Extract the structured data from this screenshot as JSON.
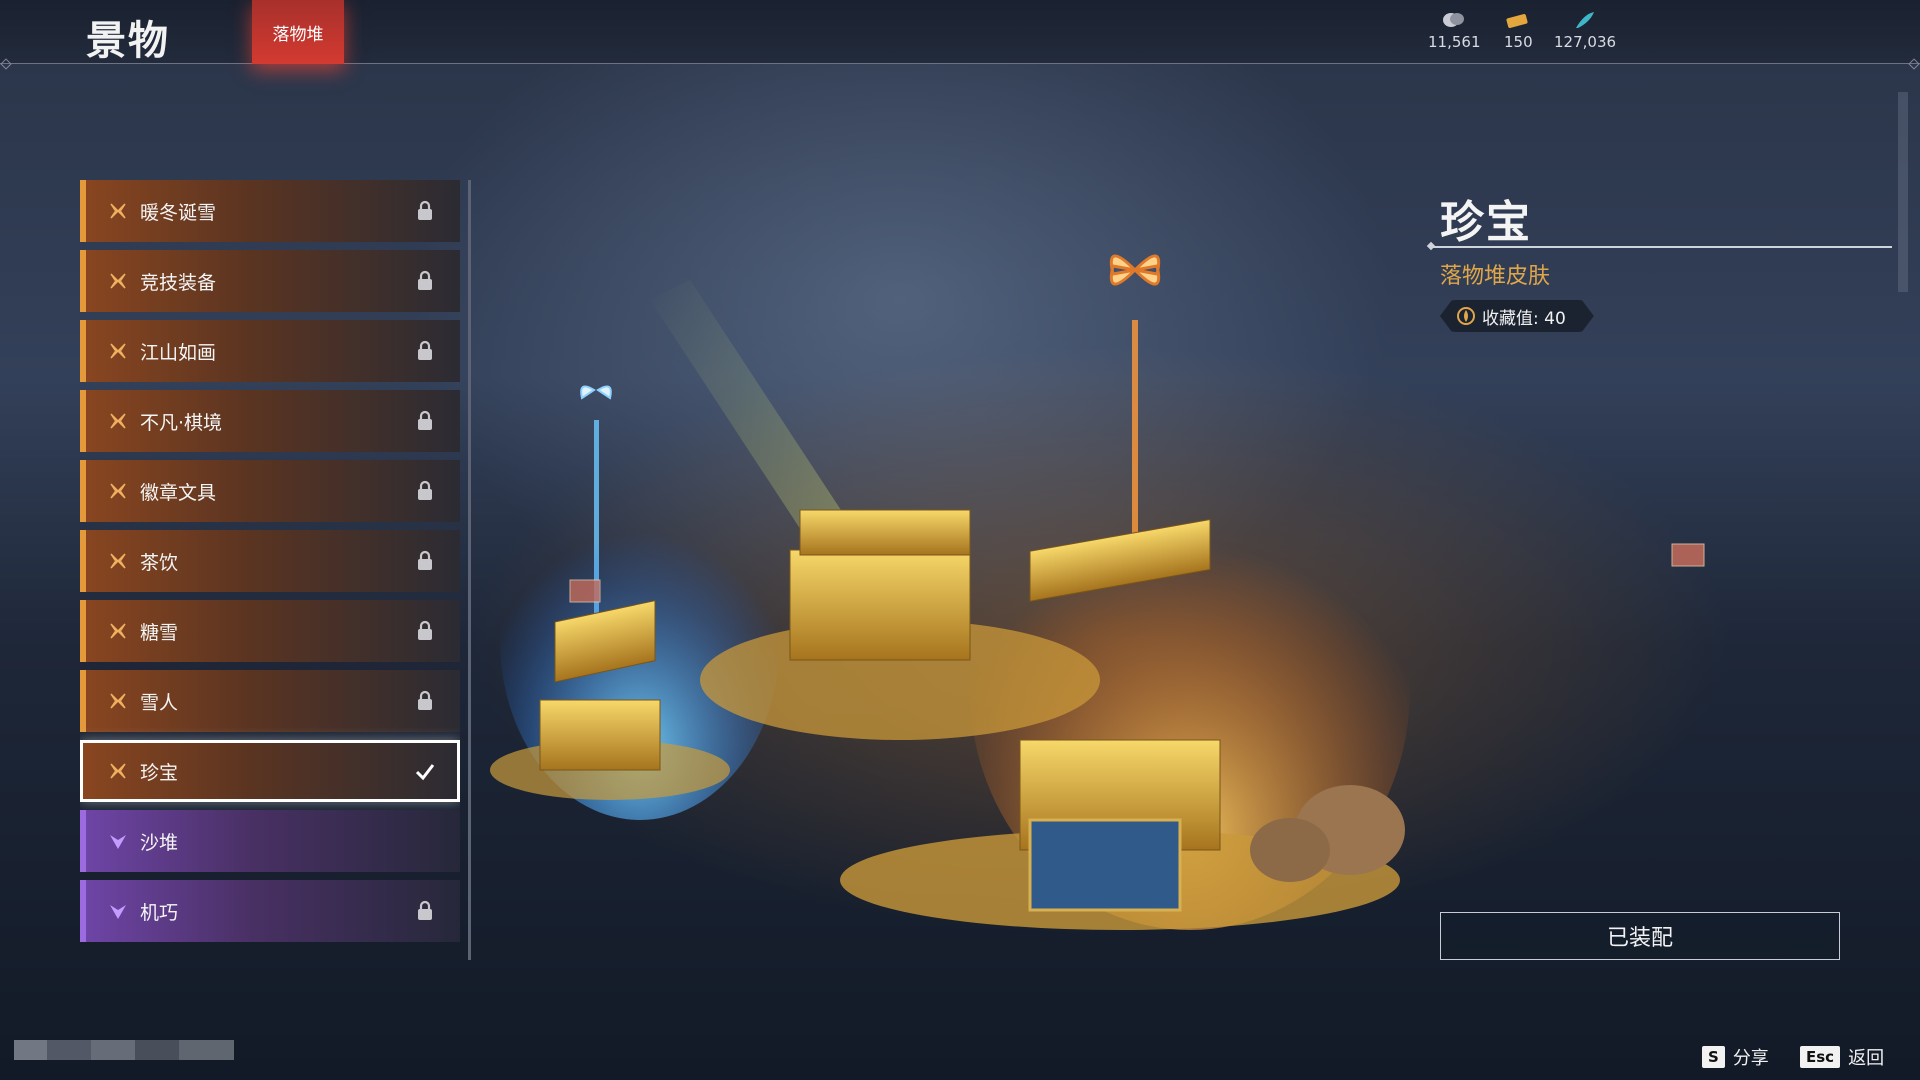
{
  "header": {
    "title": "景物",
    "active_tab": "落物堆",
    "currencies": [
      {
        "icon": "coin-stack-icon",
        "value": "11,561"
      },
      {
        "icon": "ticket-icon",
        "value": "150"
      },
      {
        "icon": "feather-icon",
        "value": "127,036"
      }
    ]
  },
  "list": {
    "items": [
      {
        "label": "暖冬诞雪",
        "rarity": "orange",
        "state": "locked"
      },
      {
        "label": "竞技装备",
        "rarity": "orange",
        "state": "locked"
      },
      {
        "label": "江山如画",
        "rarity": "orange",
        "state": "locked"
      },
      {
        "label": "不凡·棋境",
        "rarity": "orange",
        "state": "locked"
      },
      {
        "label": "徽章文具",
        "rarity": "orange",
        "state": "locked"
      },
      {
        "label": "茶饮",
        "rarity": "orange",
        "state": "locked"
      },
      {
        "label": "糖雪",
        "rarity": "orange",
        "state": "locked"
      },
      {
        "label": "雪人",
        "rarity": "orange",
        "state": "locked"
      },
      {
        "label": "珍宝",
        "rarity": "orange",
        "state": "equipped",
        "selected": true
      },
      {
        "label": "沙堆",
        "rarity": "purple",
        "state": "none"
      },
      {
        "label": "机巧",
        "rarity": "purple",
        "state": "locked"
      }
    ]
  },
  "detail": {
    "title": "珍宝",
    "subtitle": "落物堆皮肤",
    "collect_label": "收藏值: 40",
    "equip_button": "已装配"
  },
  "footer": {
    "share_key": "S",
    "share_label": "分享",
    "back_key": "Esc",
    "back_label": "返回"
  },
  "colors": {
    "accent_red": "#d33a30",
    "orange_rarity": "#e49a3a",
    "purple_rarity": "#9d6be0",
    "gold_text": "#e0a64a"
  }
}
